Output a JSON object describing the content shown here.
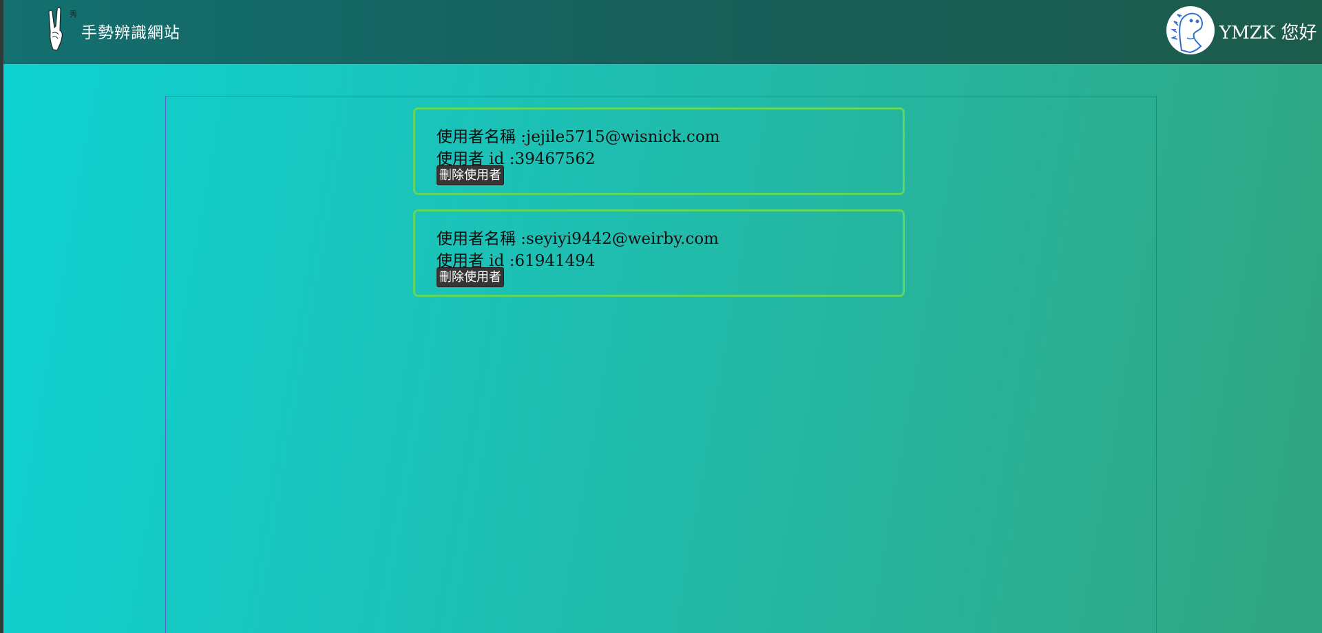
{
  "navbar": {
    "logo_icon": "rock-hand-icon",
    "site_title": "手勢辨識網站",
    "avatar_icon": "dinosaur-avatar-icon",
    "greeting": "YMZK 您好"
  },
  "users": [
    {
      "name_label": "使用者名稱 :jejile5715@wisnick.com",
      "id_label": "使用者 id :39467562",
      "delete_label": "刪除使用者"
    },
    {
      "name_label": "使用者名稱 :seyiyi9442@weirby.com",
      "id_label": "使用者 id :61941494",
      "delete_label": "刪除使用者"
    }
  ],
  "colors": {
    "navbar": "#137070",
    "background_start": "#0ed2d2",
    "background_end": "#31a57f",
    "card_border": "#5fd860",
    "button_bg": "#353535"
  }
}
